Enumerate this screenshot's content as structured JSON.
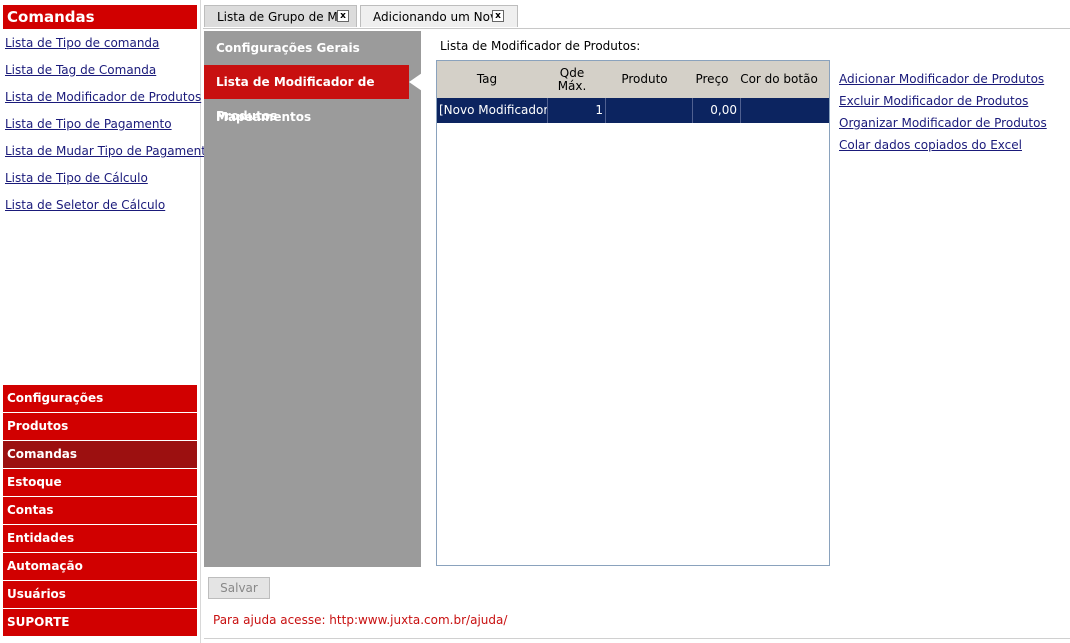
{
  "left_panel": {
    "title": "Comandas",
    "links": [
      "Lista de Tipo de comanda",
      "Lista de Tag de Comanda",
      "Lista de Modificador de Produtos",
      "Lista de Tipo de Pagamento",
      "Lista de Mudar Tipo de Pagamento",
      "Lista de Tipo de Cálculo",
      "Lista de Seletor de Cálculo"
    ]
  },
  "nav": {
    "items": [
      "Configurações",
      "Produtos",
      "Comandas",
      "Estoque",
      "Contas",
      "Entidades",
      "Automação",
      "Usuários",
      "SUPORTE"
    ],
    "active": "Comandas"
  },
  "tabs": [
    {
      "label": "Lista de Grupo de Mo",
      "close": "x"
    },
    {
      "label": "Adicionando um Novo",
      "close": "x"
    }
  ],
  "side_menu": {
    "items": [
      "Configurações Gerais",
      "Lista de Modificador de Produtos",
      "Mapeamentos"
    ],
    "active": "Lista de Modificador de Produtos"
  },
  "list": {
    "label": "Lista de Modificador de Produtos:",
    "columns": [
      "Tag",
      "Qde Máx.",
      "Produto",
      "Preço",
      "Cor do botão"
    ],
    "rows": [
      {
        "tag": "[Novo Modificador]",
        "qde_max": "1",
        "produto": "",
        "preco": "0,00",
        "cor": ""
      }
    ]
  },
  "actions": [
    "Adicionar Modificador de Produtos",
    "Excluir Modificador de Produtos",
    "Organizar Modificador de Produtos",
    "Colar dados copiados do Excel"
  ],
  "save_label": "Salvar",
  "help_text": "Para ajuda acesse: http:www.juxta.com.br/ajuda/",
  "colors": {
    "brand_red": "#d10000",
    "active_nav": "#9c1010",
    "selected_row": "#0c2460",
    "side_bg": "#9b9b9b"
  }
}
